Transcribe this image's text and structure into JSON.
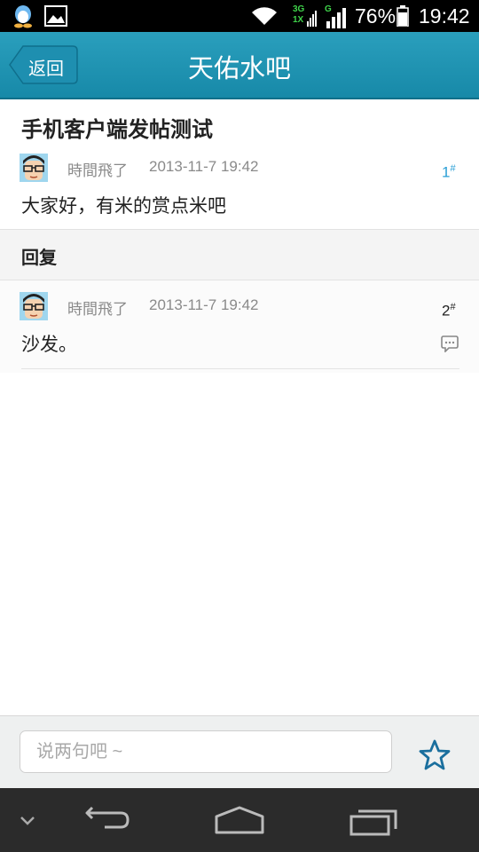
{
  "status_bar": {
    "network_top": "3G",
    "network_bottom": "1X",
    "network_g": "G",
    "battery": "76%",
    "time": "19:42",
    "icons": [
      "qq-icon",
      "image-icon",
      "wifi-icon",
      "signal-icon",
      "battery-icon"
    ]
  },
  "header": {
    "back_label": "返回",
    "title": "天佑水吧"
  },
  "post": {
    "title": "手机客户端发帖测试",
    "author": "時間飛了",
    "time": "2013-11-7 19:42",
    "floor": "1",
    "floor_mark": "#",
    "content": "大家好，有米的赏点米吧"
  },
  "reply_section": {
    "label": "回复"
  },
  "replies": [
    {
      "author": "時間飛了",
      "time": "2013-11-7 19:42",
      "floor": "2",
      "floor_mark": "#",
      "content": "沙发。"
    }
  ],
  "input_bar": {
    "placeholder": "说两句吧 ~",
    "value": ""
  },
  "colors": {
    "header": "#2196b7",
    "floor_primary": "#2a9fd6",
    "star": "#1a6f9e"
  }
}
